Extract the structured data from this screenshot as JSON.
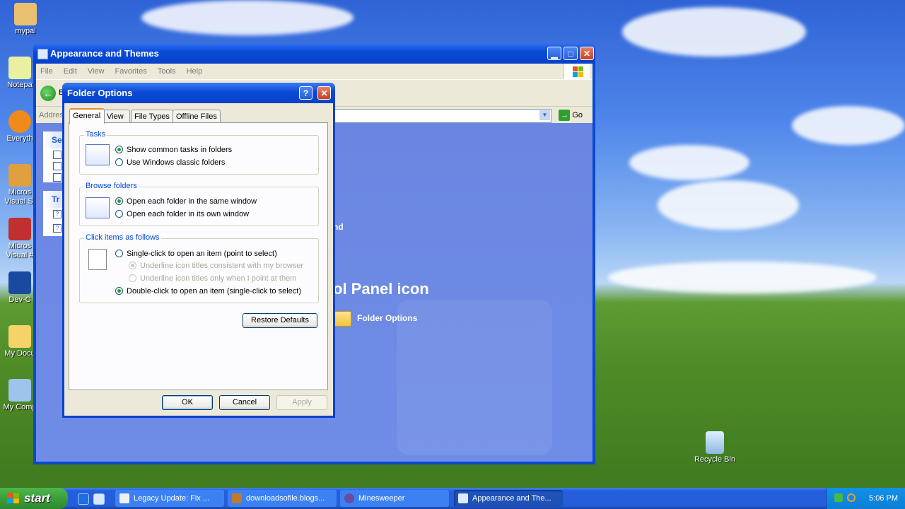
{
  "desktop": {
    "icons": [
      {
        "label": "mypal"
      },
      {
        "label": "Notepa"
      },
      {
        "label": "Everyth"
      },
      {
        "label": "Micros Visual St"
      },
      {
        "label": "Micros Visual #"
      },
      {
        "label": "Dev-C"
      },
      {
        "label": "My Docu"
      },
      {
        "label": "My Comp"
      }
    ],
    "recycle_bin": "Recycle Bin"
  },
  "explorer": {
    "title": "Appearance and Themes",
    "menu": [
      "File",
      "Edit",
      "View",
      "Favorites",
      "Tools",
      "Help"
    ],
    "back_text": "B",
    "address_label": "Addres",
    "go_label": "Go",
    "left_pane": {
      "box1_header": "Se",
      "box2_header": "Tr"
    },
    "content": {
      "truncated_text": "nd",
      "heading": "ol Panel icon",
      "link": "Folder Options"
    }
  },
  "dialog": {
    "title": "Folder Options",
    "help": "?",
    "close": "✕",
    "tabs": [
      "General",
      "View",
      "File Types",
      "Offline Files"
    ],
    "tasks": {
      "title": "Tasks",
      "options": [
        "Show common tasks in folders",
        "Use Windows classic folders"
      ],
      "selected": 0
    },
    "browse": {
      "title": "Browse folders",
      "options": [
        "Open each folder in the same window",
        "Open each folder in its own window"
      ],
      "selected": 0
    },
    "click": {
      "title": "Click items as follows",
      "single": "Single-click to open an item (point to select)",
      "underline_browser": "Underline icon titles consistent with my browser",
      "underline_point": "Underline icon titles only when I point at them",
      "double": "Double-click to open an item (single-click to select)"
    },
    "restore_defaults": "Restore Defaults",
    "ok": "OK",
    "cancel": "Cancel",
    "apply": "Apply"
  },
  "taskbar": {
    "start": "start",
    "tasks": [
      {
        "label": "Legacy Update: Fix ..."
      },
      {
        "label": "downloadsofile.blogs..."
      },
      {
        "label": "Minesweeper"
      },
      {
        "label": "Appearance and The..."
      }
    ],
    "clock": "5:06 PM"
  }
}
